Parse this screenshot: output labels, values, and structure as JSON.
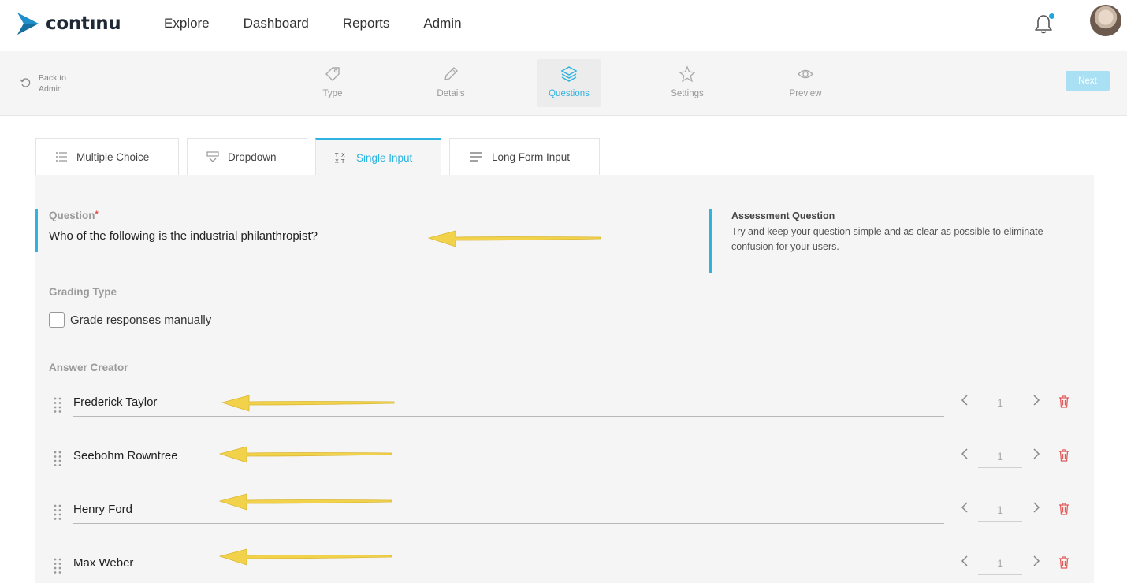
{
  "brand": {
    "name": "contınu",
    "accent": "#2fb3e0"
  },
  "nav": {
    "items": [
      "Explore",
      "Dashboard",
      "Reports",
      "Admin"
    ]
  },
  "header": {
    "notification_icon": "bell-icon",
    "avatar": "user-avatar"
  },
  "stepbar": {
    "back_line1": "Back to",
    "back_line2": "Admin",
    "steps": [
      {
        "label": "Type",
        "icon": "tag-icon"
      },
      {
        "label": "Details",
        "icon": "pencil-icon"
      },
      {
        "label": "Questions",
        "icon": "layers-icon",
        "active": true
      },
      {
        "label": "Settings",
        "icon": "star-icon"
      },
      {
        "label": "Preview",
        "icon": "eye-icon"
      }
    ],
    "next_label": "Next"
  },
  "question_types": [
    {
      "label": "Multiple Choice",
      "icon": "list-icon"
    },
    {
      "label": "Dropdown",
      "icon": "dropdown-icon"
    },
    {
      "label": "Single Input",
      "icon": "text-format-icon",
      "active": true
    },
    {
      "label": "Long Form Input",
      "icon": "paragraph-icon"
    }
  ],
  "question": {
    "label": "Question",
    "required_mark": "*",
    "value": "Who of the following is the industrial philanthropist?"
  },
  "hint": {
    "title": "Assessment Question",
    "text": "Try and keep your question simple and as clear as possible to eliminate confusion for your users."
  },
  "grading": {
    "label": "Grading Type",
    "checkbox_label": "Grade responses manually",
    "checked": false
  },
  "answers": {
    "label": "Answer Creator",
    "items": [
      {
        "text": "Frederick Taylor",
        "score": "1"
      },
      {
        "text": "Seebohm Rowntree",
        "score": "1"
      },
      {
        "text": "Henry Ford",
        "score": "1"
      },
      {
        "text": "Max Weber",
        "score": "1"
      }
    ]
  },
  "colors": {
    "accent": "#2fb3e0",
    "next_button": "#a9e0f3",
    "delete": "#e05c5c",
    "annotation_arrow": "#f2d24b"
  }
}
